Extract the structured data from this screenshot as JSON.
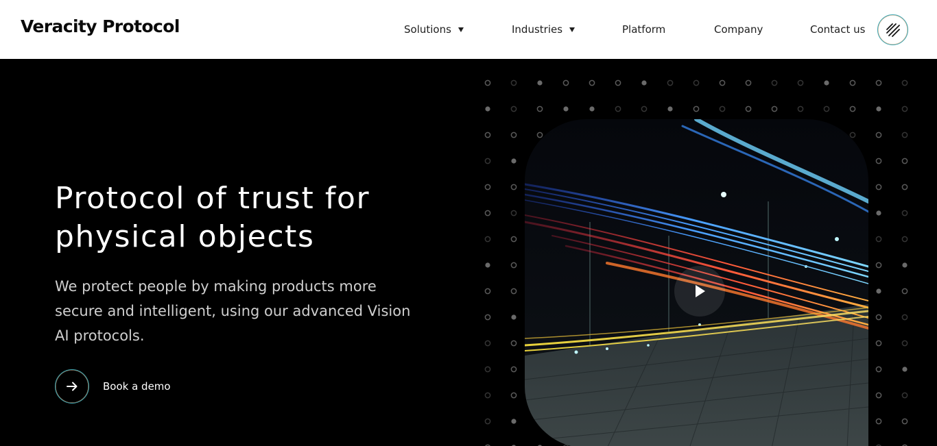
{
  "header": {
    "logo": "Veracity Protocol",
    "nav": [
      {
        "label": "Solutions",
        "has_dropdown": true
      },
      {
        "label": "Industries",
        "has_dropdown": true
      },
      {
        "label": "Platform",
        "has_dropdown": false
      },
      {
        "label": "Company",
        "has_dropdown": false
      },
      {
        "label": "Contact us",
        "has_dropdown": false
      }
    ],
    "brand_button_icon": "veracity-mark-icon"
  },
  "hero": {
    "headline_line1": "Protocol of trust for",
    "headline_line2": "physical objects",
    "subhead": "We protect people by making products more secure and intelligent, using our advanced Vision AI protocols.",
    "cta_label": "Book a demo",
    "cta_icon": "arrow-right-icon",
    "media": {
      "description_icon": "video-thumbnail",
      "play_icon": "play-icon"
    }
  },
  "colors": {
    "background": "#000000",
    "header_bg": "#ffffff",
    "accent_teal": "#3aa8b5",
    "accent_orange": "#e7a070"
  }
}
